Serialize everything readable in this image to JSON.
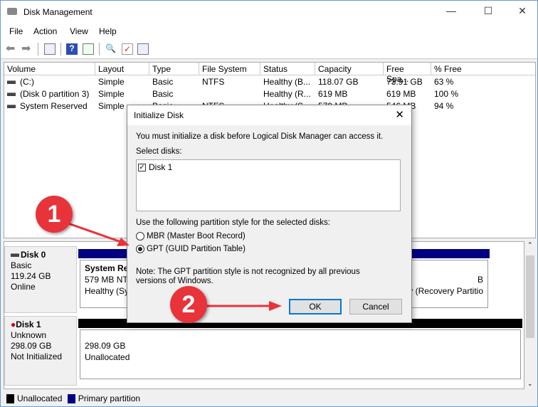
{
  "window": {
    "title": "Disk Management"
  },
  "menu": [
    "File",
    "Action",
    "View",
    "Help"
  ],
  "volumes": {
    "headers": [
      "Volume",
      "Layout",
      "Type",
      "File System",
      "Status",
      "Capacity",
      "Free Spa...",
      "% Free"
    ],
    "rows": [
      [
        "(C:)",
        "Simple",
        "Basic",
        "NTFS",
        "Healthy (B...",
        "118.07 GB",
        "73.91 GB",
        "63 %"
      ],
      [
        "(Disk 0 partition 3)",
        "Simple",
        "Basic",
        "",
        "Healthy (R...",
        "619 MB",
        "619 MB",
        "100 %"
      ],
      [
        "System Reserved",
        "Simple",
        "Basic",
        "NTFS",
        "Healthy (S...",
        "579 MB",
        "546 MB",
        "94 %"
      ]
    ]
  },
  "disks": [
    {
      "name": "Disk 0",
      "type": "Basic",
      "size": "119.24 GB",
      "state": "Online",
      "partitions": [
        {
          "name": "System Res",
          "line2": "579 MB NTF",
          "line3": "Healthy (Sys"
        },
        {
          "line2": "B",
          "line3": "y (Recovery Partitio"
        }
      ]
    },
    {
      "name": "Disk 1",
      "type": "Unknown",
      "size": "298.09 GB",
      "state": "Not Initialized",
      "partitions": [
        {
          "line2": "298.09 GB",
          "line3": "Unallocated"
        }
      ]
    }
  ],
  "legend": [
    {
      "label": "Unallocated",
      "color": "#000000"
    },
    {
      "label": "Primary partition",
      "color": "#000080"
    }
  ],
  "dialog": {
    "title": "Initialize Disk",
    "message": "You must initialize a disk before Logical Disk Manager can access it.",
    "select_label": "Select disks:",
    "disks": [
      {
        "label": "Disk 1",
        "checked": true
      }
    ],
    "style_label": "Use the following partition style for the selected disks:",
    "options": [
      {
        "label": "MBR (Master Boot Record)",
        "selected": false
      },
      {
        "label": "GPT (GUID Partition Table)",
        "selected": true
      }
    ],
    "note": "Note: The GPT partition style is not recognized by all previous versions of Windows.",
    "ok": "OK",
    "cancel": "Cancel"
  },
  "annotations": [
    "1",
    "2"
  ],
  "colors": {
    "annotation": "#e8333a",
    "primary": "#000080",
    "focus": "#0078d7"
  }
}
